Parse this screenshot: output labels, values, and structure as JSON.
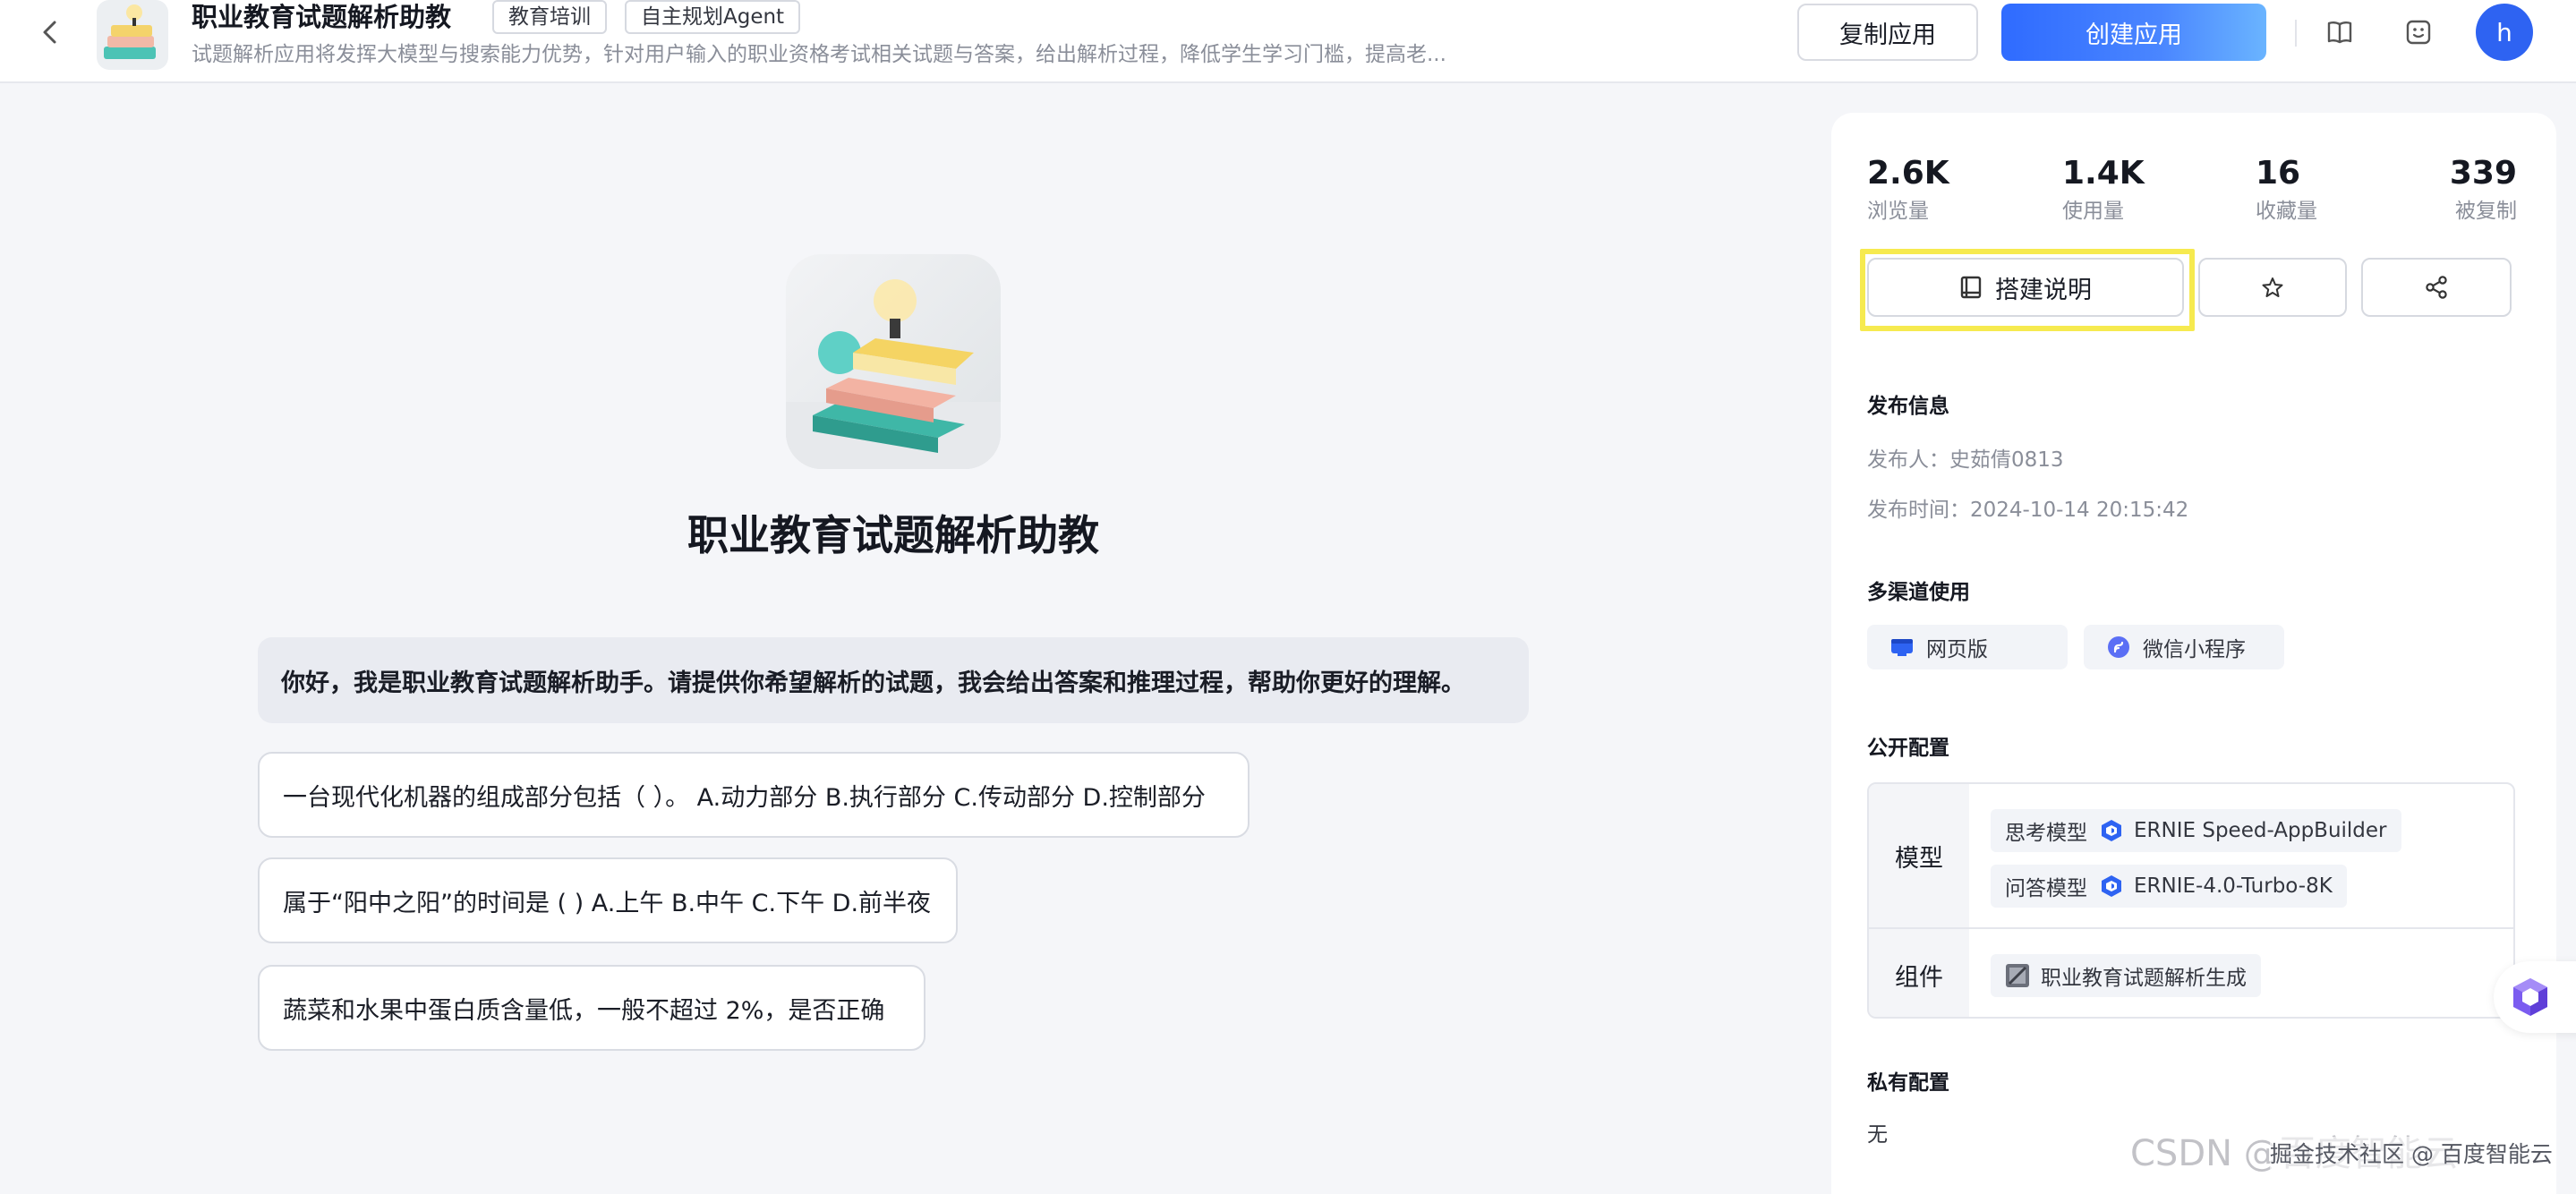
{
  "header": {
    "app_title": "职业教育试题解析助教",
    "tags": [
      "教育培训",
      "自主规划Agent"
    ],
    "description": "试题解析应用将发挥大模型与搜索能力优势，针对用户输入的职业资格考试相关试题与答案，给出解析过程，降低学生学习门槛，提高老...",
    "copy_label": "复制应用",
    "create_label": "创建应用",
    "avatar_letter": "h"
  },
  "main": {
    "title": "职业教育试题解析助教",
    "welcome": "你好，我是职业教育试题解析助手。请提供你希望解析的试题，我会给出答案和推理过程，帮助你更好的理解。",
    "questions": [
      "一台现代化机器的组成部分包括（ ）。 A.动力部分 B.执行部分 C.传动部分 D.控制部分",
      "属于“阳中之阳”的时间是 ( ) A.上午 B.中午 C.下午 D.前半夜",
      "蔬菜和水果中蛋白质含量低，一般不超过 2%，是否正确"
    ]
  },
  "panel": {
    "stats": [
      {
        "value": "2.6K",
        "label": "浏览量"
      },
      {
        "value": "1.4K",
        "label": "使用量"
      },
      {
        "value": "16",
        "label": "收藏量"
      },
      {
        "value": "339",
        "label": "被复制"
      }
    ],
    "guide_label": "搭建说明",
    "publish_title": "发布信息",
    "publisher": "发布人：史茹倩0813",
    "publish_time": "发布时间：2024-10-14 20:15:42",
    "channels_title": "多渠道使用",
    "channels": [
      "网页版",
      "微信小程序"
    ],
    "public_title": "公开配置",
    "model_head": "模型",
    "think_label": "思考模型",
    "think_model": "ERNIE Speed-AppBuilder",
    "answer_label": "问答模型",
    "answer_model": "ERNIE-4.0-Turbo-8K",
    "component_head": "组件",
    "component": "职业教育试题解析生成",
    "private_title": "私有配置",
    "private_value": "无"
  },
  "watermark": "CSDN @百度智能云",
  "watermark_sub": "掘金技术社区 @ 百度智能云",
  "colors": {
    "primary": "#2e63f2",
    "highlight": "#f6ea4f",
    "background": "#f5f6f9"
  }
}
